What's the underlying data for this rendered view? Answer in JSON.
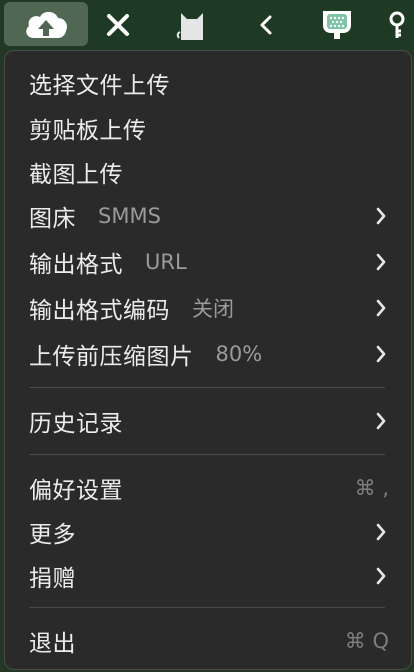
{
  "menubar": {
    "icons": [
      "cloud-upload-icon",
      "x-icon",
      "cat-icon",
      "chevron-left-icon",
      "disc-icon",
      "key-icon"
    ]
  },
  "menu": {
    "items": [
      {
        "label": "选择文件上传"
      },
      {
        "label": "剪贴板上传"
      },
      {
        "label": "截图上传"
      },
      {
        "label": "图床",
        "value": "SMMS",
        "has_submenu": true
      },
      {
        "label": "输出格式",
        "value": "URL",
        "has_submenu": true
      },
      {
        "label": "输出格式编码",
        "value": "关闭",
        "has_submenu": true
      },
      {
        "label": "上传前压缩图片",
        "value": "80%",
        "has_submenu": true
      },
      {
        "label": "历史记录",
        "has_submenu": true
      },
      {
        "label": "偏好设置",
        "shortcut": "⌘ ,"
      },
      {
        "label": "更多",
        "has_submenu": true
      },
      {
        "label": "捐赠",
        "has_submenu": true
      },
      {
        "label": "退出",
        "shortcut": "⌘ Q"
      }
    ]
  },
  "colors": {
    "menubar_bg": "#1f3a24",
    "menu_bg": "#2a2a2a",
    "text": "#ececec",
    "secondary_text": "#9a9a9a",
    "separator": "#4a4a4a"
  }
}
